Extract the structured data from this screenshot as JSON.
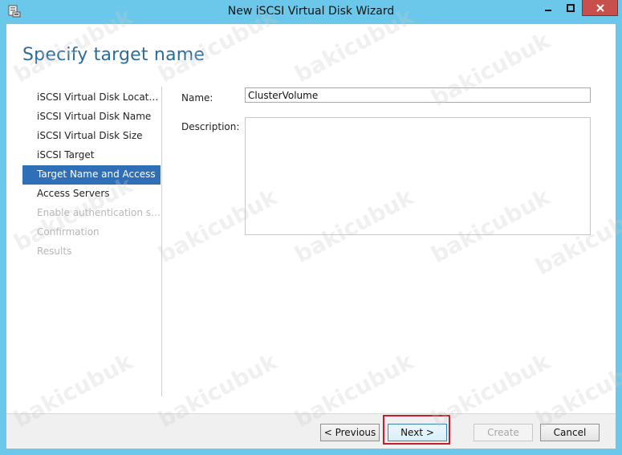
{
  "window": {
    "title": "New iSCSI Virtual Disk Wizard",
    "icon": "wizard-app-icon",
    "controls": {
      "minimize": "–",
      "maximize": "□",
      "close": "✕"
    }
  },
  "page": {
    "header": "Specify target name"
  },
  "nav": {
    "items": [
      {
        "label": "iSCSI Virtual Disk Location",
        "state": "normal"
      },
      {
        "label": "iSCSI Virtual Disk Name",
        "state": "normal"
      },
      {
        "label": "iSCSI Virtual Disk Size",
        "state": "normal"
      },
      {
        "label": "iSCSI Target",
        "state": "normal"
      },
      {
        "label": "Target Name and Access",
        "state": "selected"
      },
      {
        "label": "Access Servers",
        "state": "normal"
      },
      {
        "label": "Enable authentication ser...",
        "state": "disabled"
      },
      {
        "label": "Confirmation",
        "state": "disabled"
      },
      {
        "label": "Results",
        "state": "disabled"
      }
    ]
  },
  "form": {
    "name_label": "Name:",
    "name_value": "ClusterVolume",
    "description_label": "Description:",
    "description_value": ""
  },
  "footer": {
    "previous": "< Previous",
    "next": "Next >",
    "create": "Create",
    "cancel": "Cancel"
  },
  "watermark": "bakicubuk",
  "colors": {
    "window_frame": "#6bc8ea",
    "header_text": "#2b6e9a",
    "selected_nav": "#2f6fb7",
    "close_button": "#c7504c",
    "highlight_box": "#c0202a"
  }
}
